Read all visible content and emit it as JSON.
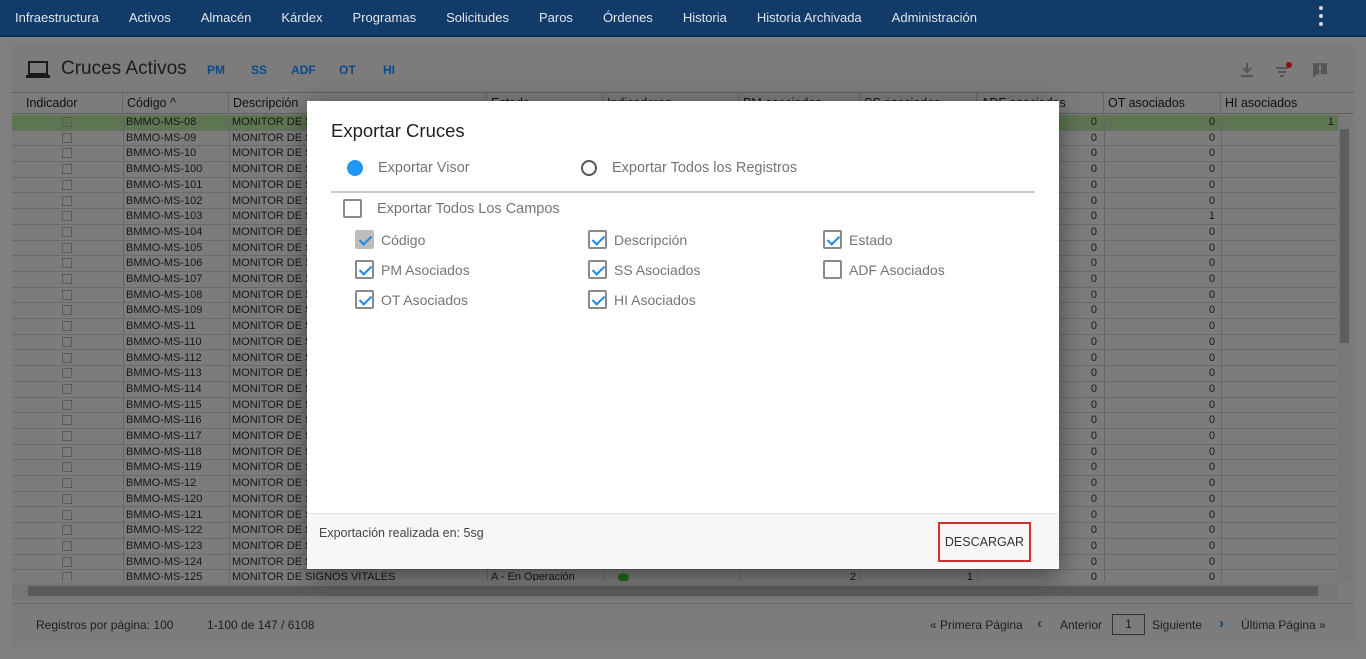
{
  "nav": {
    "items": [
      "Infraestructura",
      "Activos",
      "Almacén",
      "Kárdex",
      "Programas",
      "Solicitudes",
      "Paros",
      "Órdenes",
      "Historia",
      "Historia Archivada",
      "Administración"
    ]
  },
  "panel": {
    "title": "Cruces Activos",
    "links": [
      "PM",
      "SS",
      "ADF",
      "OT",
      "HI"
    ]
  },
  "table": {
    "columns": [
      "Indicador",
      "Código ^",
      "Descripción",
      "Estado",
      "Indicadores",
      "PM asociados",
      "SS asociados",
      "ADF asociados",
      "OT asociados",
      "HI asociados"
    ],
    "rows": [
      {
        "code": "BMMO-MS-08",
        "desc": "MONITOR DE S",
        "adf": "0",
        "ot": "0",
        "hi": "1"
      },
      {
        "code": "BMMO-MS-09",
        "desc": "MONITOR DE S",
        "adf": "0",
        "ot": "0"
      },
      {
        "code": "BMMO-MS-10",
        "desc": "MONITOR DE S",
        "adf": "0",
        "ot": "0"
      },
      {
        "code": "BMMO-MS-100",
        "desc": "MONITOR DE S",
        "adf": "0",
        "ot": "0"
      },
      {
        "code": "BMMO-MS-101",
        "desc": "MONITOR DE S",
        "adf": "0",
        "ot": "0"
      },
      {
        "code": "BMMO-MS-102",
        "desc": "MONITOR DE S",
        "adf": "0",
        "ot": "0"
      },
      {
        "code": "BMMO-MS-103",
        "desc": "MONITOR DE S",
        "adf": "0",
        "ot": "1"
      },
      {
        "code": "BMMO-MS-104",
        "desc": "MONITOR DE S",
        "adf": "0",
        "ot": "0"
      },
      {
        "code": "BMMO-MS-105",
        "desc": "MONITOR DE S",
        "adf": "0",
        "ot": "0"
      },
      {
        "code": "BMMO-MS-106",
        "desc": "MONITOR DE S",
        "adf": "0",
        "ot": "0"
      },
      {
        "code": "BMMO-MS-107",
        "desc": "MONITOR DE S",
        "adf": "0",
        "ot": "0"
      },
      {
        "code": "BMMO-MS-108",
        "desc": "MONITOR DE S",
        "adf": "0",
        "ot": "0"
      },
      {
        "code": "BMMO-MS-109",
        "desc": "MONITOR DE S",
        "adf": "0",
        "ot": "0"
      },
      {
        "code": "BMMO-MS-11",
        "desc": "MONITOR DE S",
        "adf": "0",
        "ot": "0"
      },
      {
        "code": "BMMO-MS-110",
        "desc": "MONITOR DE S",
        "adf": "0",
        "ot": "0"
      },
      {
        "code": "BMMO-MS-112",
        "desc": "MONITOR DE S",
        "adf": "0",
        "ot": "0"
      },
      {
        "code": "BMMO-MS-113",
        "desc": "MONITOR DE S",
        "adf": "0",
        "ot": "0"
      },
      {
        "code": "BMMO-MS-114",
        "desc": "MONITOR DE S",
        "adf": "0",
        "ot": "0"
      },
      {
        "code": "BMMO-MS-115",
        "desc": "MONITOR DE S",
        "adf": "0",
        "ot": "0"
      },
      {
        "code": "BMMO-MS-116",
        "desc": "MONITOR DE S",
        "adf": "0",
        "ot": "0"
      },
      {
        "code": "BMMO-MS-117",
        "desc": "MONITOR DE S",
        "adf": "0",
        "ot": "0"
      },
      {
        "code": "BMMO-MS-118",
        "desc": "MONITOR DE S",
        "adf": "0",
        "ot": "0"
      },
      {
        "code": "BMMO-MS-119",
        "desc": "MONITOR DE S",
        "adf": "0",
        "ot": "0"
      },
      {
        "code": "BMMO-MS-12",
        "desc": "MONITOR DE S",
        "adf": "0",
        "ot": "0"
      },
      {
        "code": "BMMO-MS-120",
        "desc": "MONITOR DE S",
        "adf": "0",
        "ot": "0"
      },
      {
        "code": "BMMO-MS-121",
        "desc": "MONITOR DE S",
        "adf": "0",
        "ot": "0"
      },
      {
        "code": "BMMO-MS-122",
        "desc": "MONITOR DE S",
        "adf": "0",
        "ot": "0"
      },
      {
        "code": "BMMO-MS-123",
        "desc": "MONITOR DE S",
        "adf": "0",
        "ot": "0"
      },
      {
        "code": "BMMO-MS-124",
        "desc": "MONITOR DE S",
        "adf": "0",
        "ot": "0"
      },
      {
        "code": "BMMO-MS-125",
        "desc": "MONITOR DE SIGNOS VITALES",
        "estado": "A - En Operación",
        "indicator": "green",
        "pm": "2",
        "ss": "1",
        "adf": "0",
        "ot": "0"
      }
    ]
  },
  "footer": {
    "per_page": "Registros por página: 100",
    "range": "1-100 de 147 / 6108",
    "first": "« Primera Página",
    "prev": "Anterior",
    "page": "1",
    "next": "Siguiente",
    "last": "Última Página »"
  },
  "modal": {
    "title": "Exportar Cruces",
    "radio_viewer": "Exportar Visor",
    "radio_all": "Exportar Todos los Registros",
    "all_fields": "Exportar Todos Los Campos",
    "fields": [
      {
        "label": "Código",
        "checked": true,
        "disabled": true
      },
      {
        "label": "Descripción",
        "checked": true
      },
      {
        "label": "Estado",
        "checked": true
      },
      {
        "label": "PM Asociados",
        "checked": true
      },
      {
        "label": "SS Asociados",
        "checked": true
      },
      {
        "label": "ADF Asociados",
        "checked": false
      },
      {
        "label": "OT Asociados",
        "checked": true
      },
      {
        "label": "HI Asociados",
        "checked": true
      }
    ],
    "export_time": "Exportación realizada en: 5sg",
    "download": "DESCARGAR"
  },
  "colors": {
    "nav_bg": "#123b69",
    "link": "#0d4a86",
    "radio_on": "#2196f3",
    "check": "#1e88e5",
    "download_border": "#d32f2f",
    "indicator_green": "#1f6b1f"
  }
}
